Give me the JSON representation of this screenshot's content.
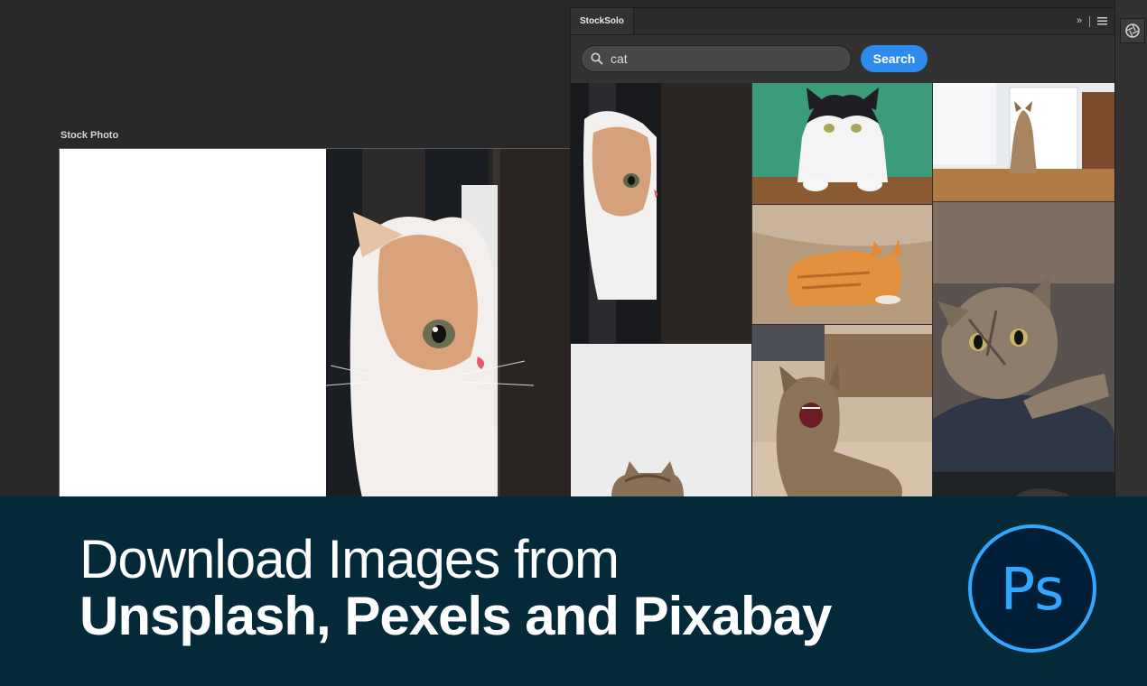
{
  "document": {
    "title": "Stock Photo"
  },
  "panel": {
    "tab_label": "StockSolo",
    "expand_label": "»",
    "search": {
      "value": "cat",
      "button_label": "Search"
    },
    "results": [
      {
        "id": "kitten-window"
      },
      {
        "id": "cat-green"
      },
      {
        "id": "cat-kitchen"
      },
      {
        "id": "orange-cat"
      },
      {
        "id": "tabby-lying"
      },
      {
        "id": "white-bg-cat"
      },
      {
        "id": "yawning-kitten"
      },
      {
        "id": "dark-cat"
      }
    ]
  },
  "banner": {
    "line1": "Download Images from",
    "line2": "Unsplash, Pexels and Pixabay",
    "logo_text": "Ps"
  },
  "colors": {
    "accent": "#2d8ceb",
    "banner_bg": "#042939",
    "ps_cyan": "#31a8ff"
  }
}
